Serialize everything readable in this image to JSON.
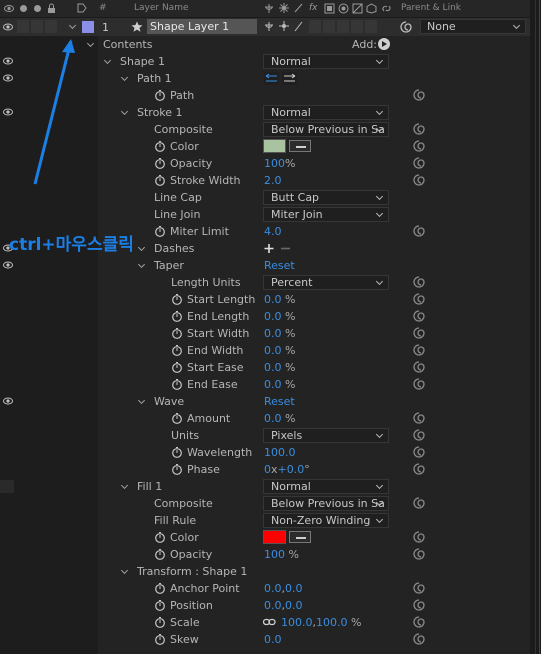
{
  "header": {
    "hash_label": "#",
    "layer_name_label": "Layer Name",
    "fx_label": "fx",
    "parent_link_label": "Parent & Link"
  },
  "layer": {
    "number": "1",
    "name": "Shape Layer 1",
    "parent": "None"
  },
  "contents": {
    "label": "Contents",
    "add_label": "Add:"
  },
  "shape1": {
    "label": "Shape 1",
    "blend": "Normal"
  },
  "path1": {
    "label": "Path 1",
    "path_label": "Path"
  },
  "stroke1": {
    "label": "Stroke 1",
    "blend": "Normal",
    "composite_label": "Composite",
    "composite_value": "Below Previous in Sa",
    "color_label": "Color",
    "color_value": "#a9c3a0",
    "opacity_label": "Opacity",
    "opacity_value": "100",
    "opacity_unit": "%",
    "stroke_width_label": "Stroke Width",
    "stroke_width_value": "2.0",
    "line_cap_label": "Line Cap",
    "line_cap_value": "Butt Cap",
    "line_join_label": "Line Join",
    "line_join_value": "Miter Join",
    "miter_limit_label": "Miter Limit",
    "miter_limit_value": "4.0",
    "dashes_label": "Dashes"
  },
  "taper": {
    "label": "Taper",
    "reset": "Reset",
    "length_units_label": "Length Units",
    "length_units_value": "Percent",
    "props": [
      {
        "label": "Start Length",
        "value": "0.0",
        "unit": "%"
      },
      {
        "label": "End Length",
        "value": "0.0",
        "unit": "%"
      },
      {
        "label": "Start Width",
        "value": "0.0",
        "unit": "%"
      },
      {
        "label": "End Width",
        "value": "0.0",
        "unit": "%"
      },
      {
        "label": "Start Ease",
        "value": "0.0",
        "unit": "%"
      },
      {
        "label": "End Ease",
        "value": "0.0",
        "unit": "%"
      }
    ]
  },
  "wave": {
    "label": "Wave",
    "reset": "Reset",
    "amount_label": "Amount",
    "amount_value": "0.0",
    "amount_unit": "%",
    "units_label": "Units",
    "units_value": "Pixels",
    "wavelength_label": "Wavelength",
    "wavelength_value": "100.0",
    "phase_label": "Phase",
    "phase_rev": "0",
    "phase_x": "x",
    "phase_deg": "+0.0",
    "phase_unit": "°"
  },
  "fill1": {
    "label": "Fill 1",
    "blend": "Normal",
    "composite_label": "Composite",
    "composite_value": "Below Previous in Sa",
    "fill_rule_label": "Fill Rule",
    "fill_rule_value": "Non-Zero Winding",
    "color_label": "Color",
    "color_value": "#ff0000",
    "opacity_label": "Opacity",
    "opacity_value": "100",
    "opacity_unit": "%"
  },
  "transform": {
    "label": "Transform : Shape 1",
    "anchor_label": "Anchor Point",
    "anchor_x": "0.0",
    "anchor_y": "0.0",
    "position_label": "Position",
    "position_x": "0.0",
    "position_y": "0.0",
    "scale_label": "Scale",
    "scale_x": "100.0",
    "scale_y": "100.0",
    "scale_unit": "%",
    "skew_label": "Skew",
    "skew_value": "0.0",
    "sep": ","
  },
  "annotation": {
    "text": "ctrl+마우스클릭",
    "color": "#1b7fe6"
  },
  "colors": {
    "accent_blue": "#3a8de0",
    "label_color": "#8c8fe8"
  }
}
